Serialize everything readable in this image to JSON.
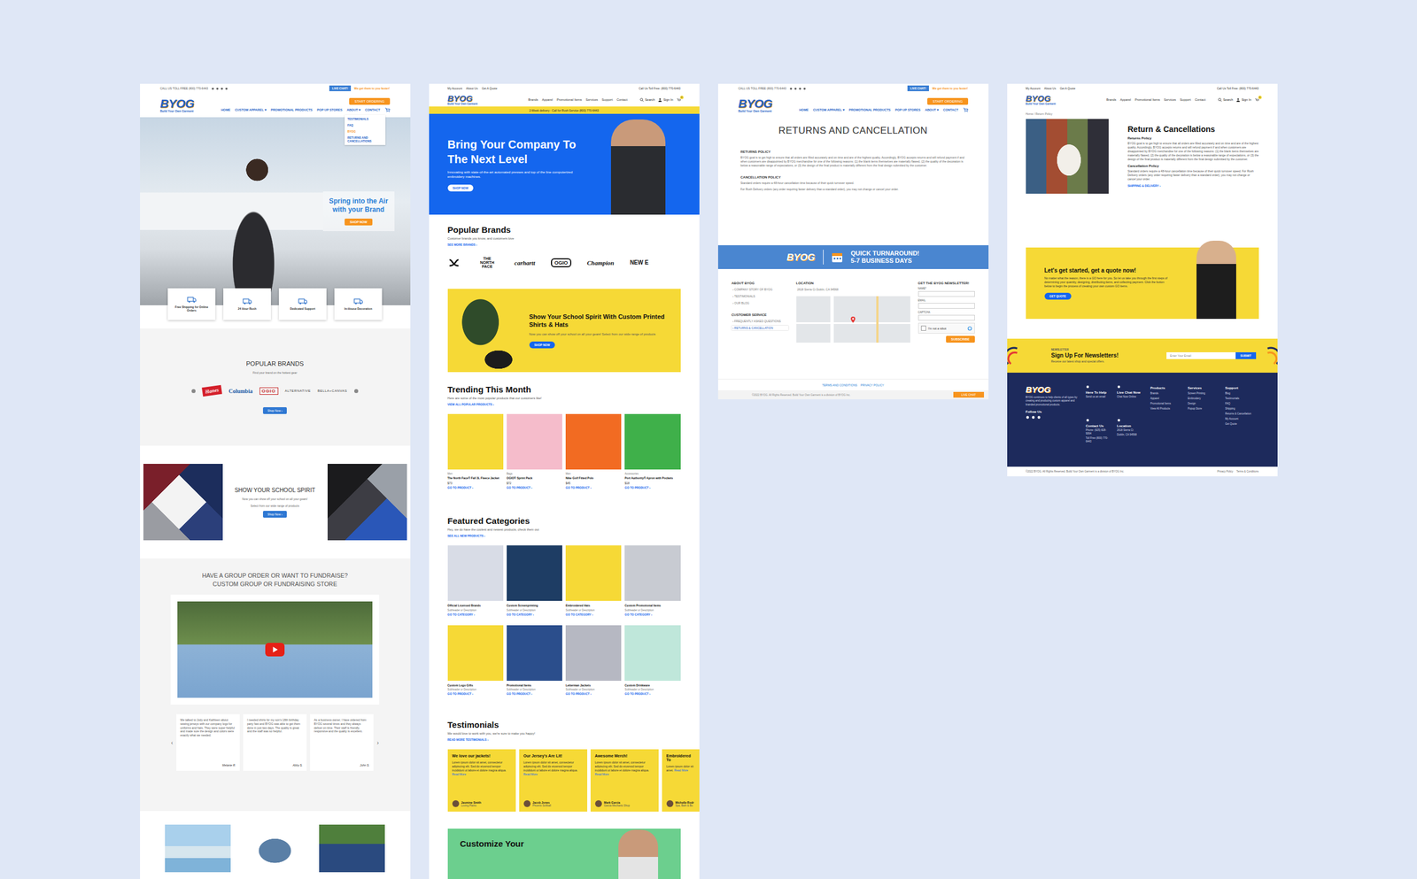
{
  "old_home": {
    "header": {
      "phone": "CALL US TOLL FREE (800) 770-6443",
      "chat": "LIVE CHAT!",
      "promo": "We get them to you faster!",
      "logo": "BYOG",
      "tagline": "Build Your Own Garment",
      "cta": "START ORDERING",
      "nav": [
        {
          "label": "HOME",
          "expanded": false,
          "menu": []
        },
        {
          "label": "CUSTOM APPAREL ▾",
          "expanded": false,
          "menu": []
        },
        {
          "label": "PROMOTIONAL PRODUCTS",
          "expanded": false,
          "menu": []
        },
        {
          "label": "POP UP STORES",
          "expanded": false,
          "menu": []
        },
        {
          "label": "ABOUT ▾",
          "expanded": true,
          "menu": [
            {
              "label": "TESTIMONIALS",
              "selected": false
            },
            {
              "label": "FAQ",
              "selected": false
            },
            {
              "label": "BYOG",
              "selected": true
            },
            {
              "label": "RETURNS AND CANCELLATIONS",
              "selected": false
            }
          ]
        },
        {
          "label": "CONTACT",
          "expanded": false,
          "menu": []
        }
      ]
    },
    "hero": {
      "title": "Spring into the Air with your Brand",
      "button": "SHOP NOW"
    },
    "features": [
      "Free Shipping for Online Orders",
      "24 Hour Rush",
      "Dedicated Support",
      "In-House Decoration"
    ],
    "brands": {
      "title": "POPULAR BRANDS",
      "subtitle": "Find your brand on the hottest gear",
      "logos": [
        {
          "name": "Hanes",
          "kind": "badge"
        },
        {
          "name": "Columbia",
          "kind": "wordmark"
        },
        {
          "name": "OGIO",
          "kind": "outline"
        },
        {
          "name": "ALTERNATIVE",
          "kind": "caps"
        },
        {
          "name": "BELLA+CANVAS",
          "kind": "caps"
        }
      ],
      "button": "Shop Now ›"
    },
    "spirit": {
      "title": "SHOW YOUR SCHOOL SPIRIT",
      "text": "Now you can show off your school on all your gears!",
      "sub": "Select from our wide range of products",
      "button": "Shop Now ›"
    },
    "group": {
      "title": "HAVE A GROUP ORDER OR WANT TO FUNDRAISE?",
      "subtitle": "CUSTOM GROUP OR FUNDRAISING STORE"
    },
    "testimonials": {
      "prev": "‹",
      "next": "›",
      "items": [
        {
          "text": "We talked to Jody and Kathleen about sewing jerseys with our company logo for uniforms and hats. They were super helpful and made sure the design and colors were exactly what we needed.",
          "author": "Melanie R."
        },
        {
          "text": "I needed shirts for my son's 18th birthday party fast and BYOG was able to get them done in just two days. The quality is great and the staff was so helpful.",
          "author": "Abby S."
        },
        {
          "text": "As a business owner, I have ordered from BYOG several times and they always deliver on time. Their staff is friendly, responsive and the quality is excellent.",
          "author": "John S."
        }
      ]
    }
  },
  "new_home": {
    "header": {
      "links": [
        "My Account",
        "About Us",
        "Get A Quote"
      ],
      "phone": "Call Us Toll Free: (800) 770-6443",
      "logo": "BYOG",
      "tagline": "Build Your Own Garment",
      "nav": [
        "Brands",
        "Apparel",
        "Promotional Items",
        "Services",
        "Support",
        "Contact"
      ],
      "search": "Search",
      "sign_in": "Sign In",
      "cart_count": "0"
    },
    "strip": "2-Week delivery - Call for Rush Service (800) 770-6443",
    "hero": {
      "title": "Bring Your Company To The Next Level",
      "text": "Innovating with state-of-the-art automated presses and top of the line computerized embroidery machines.",
      "button": "SHOP NOW"
    },
    "brands": {
      "title": "Popular Brands",
      "subtitle": "Customer brands you know, and customers love",
      "link": "SEE MORE BRANDS ›",
      "logos": [
        {
          "name": "THE NORTH FACE",
          "kind": "stack"
        },
        {
          "name": "carhartt",
          "kind": "script"
        },
        {
          "name": "OGIO",
          "kind": "outline"
        },
        {
          "name": "Champion",
          "kind": "script"
        },
        {
          "name": "NEW E",
          "kind": "caps"
        }
      ]
    },
    "spirit": {
      "title": "Show Your School Spirit With Custom Printed Shirts & Hats",
      "text": "Now you can show off your school on all your gears! Select from our wide range of products",
      "button": "SHOP NOW"
    },
    "trending": {
      "title": "Trending This Month",
      "subtitle": "Here are some of the most popular products that our customers like!",
      "link": "VIEW ALL POPULAR PRODUCTS ›",
      "items": [
        {
          "category": "Men",
          "name": "The North Face® Fall 3L Fleece Jacket",
          "price": "$73",
          "link": "GO TO PRODUCT ›",
          "color": "#f6d936"
        },
        {
          "category": "Bags",
          "name": "OGIO® Sprint Pack",
          "price": "$72",
          "link": "GO TO PRODUCT ›",
          "color": "#f5bccb"
        },
        {
          "category": "Men",
          "name": "Nike Golf Fitted Polo",
          "price": "$45",
          "link": "GO TO PRODUCT ›",
          "color": "#f26b22"
        },
        {
          "category": "Accessories",
          "name": "Port Authority® Apron with Pockets",
          "price": "$18",
          "link": "GO TO PRODUCT ›",
          "color": "#3fb04a"
        }
      ]
    },
    "featured": {
      "title": "Featured Categories",
      "subtitle": "Hey, we do have the coolest and newest products, check them out",
      "link": "SEE ALL NEW PRODUCTS ›",
      "items": [
        {
          "name": "Official Licensed Brands",
          "desc": "Subheader or Description",
          "link": "GO TO CATEGORY ›",
          "color": "#d8dce6"
        },
        {
          "name": "Custom Screenprinting",
          "desc": "Subheader or Description",
          "link": "GO TO CATEGORY ›",
          "color": "#1e3d64"
        },
        {
          "name": "Embroidered Hats",
          "desc": "Subheader or Description",
          "link": "GO TO CATEGORY ›",
          "color": "#f6d936"
        },
        {
          "name": "Custom Promotional Items",
          "desc": "Subheader or Description",
          "link": "GO TO CATEGORY ›",
          "color": "#c8cbd2"
        },
        {
          "name": "Custom Logo Gifts",
          "desc": "Subheader or Description",
          "link": "GO TO PRODUCT ›",
          "color": "#f6d936"
        },
        {
          "name": "Promotional Items",
          "desc": "Subheader or Description",
          "link": "GO TO PRODUCT ›",
          "color": "#2b4e8c"
        },
        {
          "name": "Letterman Jackets",
          "desc": "Subheader or Description",
          "link": "GO TO PRODUCT ›",
          "color": "#b6b8c2"
        },
        {
          "name": "Custom Drinkware",
          "desc": "Subheader or Description",
          "link": "GO TO PRODUCT ›",
          "color": "#bfe7da"
        }
      ]
    },
    "testimonials": {
      "title": "Testimonials",
      "subtitle": "We would love to work with you, we're sure to make you happy!",
      "link": "READ MORE TESTIMONIALS ›",
      "items": [
        {
          "title": "We love our jackets!",
          "text": "Lorem ipsum dolor sit amet, consectetur adipiscing elit. Sed do eiusmod tempor incididunt ut labore et dolore magna aliqua.",
          "more": "Read More",
          "name": "Jasmine Smith",
          "role": "Loving Plants"
        },
        {
          "title": "Our Jersey's Are Lit!",
          "text": "Lorem ipsum dolor sit amet, consectetur adipiscing elit. Sed do eiusmod tempor incididunt ut labore et dolore magna aliqua.",
          "more": "Read More",
          "name": "Jacob Jones",
          "role": "Phoenix Softball"
        },
        {
          "title": "Awesome Merch!",
          "text": "Lorem ipsum dolor sit amet, consectetur adipiscing elit. Sed do eiusmod tempor incididunt ut labore et dolore magna aliqua.",
          "more": "Read More",
          "name": "Mark Garcia",
          "role": "Garcia Mechanic Shop"
        },
        {
          "title": "Embroidered To",
          "text": "Lorem ipsum dolor sit amet.",
          "more": "Read More",
          "name": "Michelle Rodr",
          "role": "Spa, Bath & Bo"
        }
      ]
    },
    "banner": {
      "title": "Customize Your"
    }
  },
  "old_returns": {
    "header": {
      "phone": "CALL US TOLL FREE (800) 770-6443",
      "chat": "LIVE CHAT!",
      "promo": "We get them to you faster!",
      "logo": "BYOG",
      "tagline": "Build Your Own Garment",
      "cta": "START ORDERING",
      "nav": [
        "HOME",
        "CUSTOM APPAREL ▾",
        "PROMOTIONAL PRODUCTS",
        "POP UP STORES",
        "ABOUT ▾",
        "CONTACT"
      ]
    },
    "title": "RETURNS AND CANCELLATION",
    "sections": [
      {
        "heading": "RETURNS POLICY",
        "paragraphs": [
          "BYOG goal is to get high to ensure that all orders are filled accurately and on time and are of the highest quality. Accordingly, BYOG accepts returns and will refund payment if and when customers are disappointed by BYOG merchandise for one of the following reasons: (1) the blank items themselves are materially flawed, (2) the quality of the decoration is below a reasonable range of expectations, or (3) the design of the final product is materially different from the final design submitted by the customer."
        ]
      },
      {
        "heading": "CANCELLATION POLICY",
        "paragraphs": [
          "Standard orders require a 48-hour cancellation time because of their quick turnover speed.",
          "For Rush Delivery orders (any order requiring faster delivery than a standard order), you may not change or cancel your order."
        ]
      }
    ],
    "band": {
      "logo": "BYOG",
      "title": "QUICK TURNAROUND!",
      "subtitle": "5-7 BUSINESS DAYS"
    },
    "footer": {
      "about_title": "ABOUT BYOG",
      "about_links": [
        {
          "label": "COMPANY STORY OF BYOG",
          "selected": false
        },
        {
          "label": "TESTIMONIALS",
          "selected": false
        },
        {
          "label": "OUR BLOG",
          "selected": false
        }
      ],
      "service_title": "CUSTOMER SERVICE",
      "service_links": [
        {
          "label": "FREQUENTLY ASKED QUESTIONS",
          "selected": false
        },
        {
          "label": "RETURNS & CANCELLATION",
          "selected": true
        }
      ],
      "location_title": "LOCATION",
      "address": "2618 Sierra Ct Dublin, CA 94568",
      "newsletter_title": "GET THE BYOG NEWSLETTER!",
      "fields": [
        "NAME*",
        "EMAIL",
        "CAPTCHA"
      ],
      "captcha": {
        "label": "I'm not a robot",
        "checked": false
      },
      "button": "SUBSCRIBE"
    },
    "links": [
      "TERMS AND CONDITIONS",
      "PRIVACY POLICY"
    ],
    "copyright": "©2022 BYOG. All Rights Reserved. Build Your Own Garment is a division of BYOG Inc.",
    "chat": "LIVE CHAT"
  },
  "new_returns": {
    "header": {
      "links": [
        "My Account",
        "About Us",
        "Get A Quote"
      ],
      "phone": "Call Us Toll Free: (800) 770-6443",
      "logo": "BYOG",
      "tagline": "Build Your Own Garment",
      "nav": [
        "Brands",
        "Apparel",
        "Promotional Items",
        "Services",
        "Support",
        "Contact"
      ],
      "search": "Search",
      "sign_in": "Sign In",
      "cart_count": "0"
    },
    "breadcrumb": "Home / Return Policy",
    "title": "Return & Cancellations",
    "sections": [
      {
        "heading": "Returns Policy",
        "paragraphs": [
          "BYOG goal is to get high to ensure that all orders are filled accurately and on time and are of the highest quality. Accordingly, BYOG accepts returns and will refund payment if and when customers are disappointed by BYOG merchandise for one of the following reasons: (1) the blank items themselves are materially flawed, (2) the quality of the decoration is below a reasonable range of expectations, or (3) the design of the final product is materially different from the final design submitted by the customer."
        ]
      },
      {
        "heading": "Cancellation Policy",
        "paragraphs": [
          "Standard orders require a 48-hour cancellation time because of their quick turnover speed. For Rush Delivery orders (any order requiring faster delivery than a standard order), you may not change or cancel your order."
        ]
      }
    ],
    "link": "SHIPPING & DELIVERY ›",
    "quote": {
      "title": "Let's get started, get a quote now!",
      "text": "No matter what the reason, there is a GO here for you. So let us take you through the first steps of determining your quantity, designing, distributing items, and collecting payment. Click the button below to begin the process of creating your own custom GO items.",
      "button": "GET QUOTE"
    },
    "newsletter": {
      "label": "NEWSLETTER",
      "title": "Sign Up For Newsletters!",
      "text": "Receive our latest shop and special offers.",
      "placeholder": "Enter Your Email",
      "button": "SUBMIT"
    },
    "footer": {
      "logo": "BYOG",
      "about": "BYOG continues to help clients of all types by creating and producing custom apparel and branded promotional products.",
      "follow": "Follow Us",
      "contacts": [
        {
          "title": "Here To Help",
          "lines": [
            "Send us an email"
          ]
        },
        {
          "title": "Live Chat Now",
          "lines": [
            "Chat Now Online"
          ]
        },
        {
          "title": "Contact Us",
          "lines": [
            "Phone: (925) 828-9064",
            "Toll Free (800) 770-6443"
          ]
        },
        {
          "title": "Location",
          "lines": [
            "2618 Sierra Ct",
            "Dublin, CA 94568"
          ]
        }
      ],
      "columns": [
        {
          "title": "Products",
          "links": [
            "Brands",
            "Apparel",
            "Promotional Items",
            "View All Products"
          ]
        },
        {
          "title": "Services",
          "links": [
            "Screen Printing",
            "Embroidery",
            "Design",
            "Popup Store"
          ]
        },
        {
          "title": "Support",
          "links": [
            "Blog",
            "Testimonials",
            "FAQ",
            "Shipping",
            "Returns & Cancellation",
            "My Account",
            "Get Quote"
          ]
        }
      ]
    },
    "bottom": {
      "copyright": "©2022 BYOG. All Rights Reserved. Build Your Own Garment is a division of BYOG Inc.",
      "links": [
        "Privacy Policy",
        "Terms & Conditions"
      ]
    }
  }
}
